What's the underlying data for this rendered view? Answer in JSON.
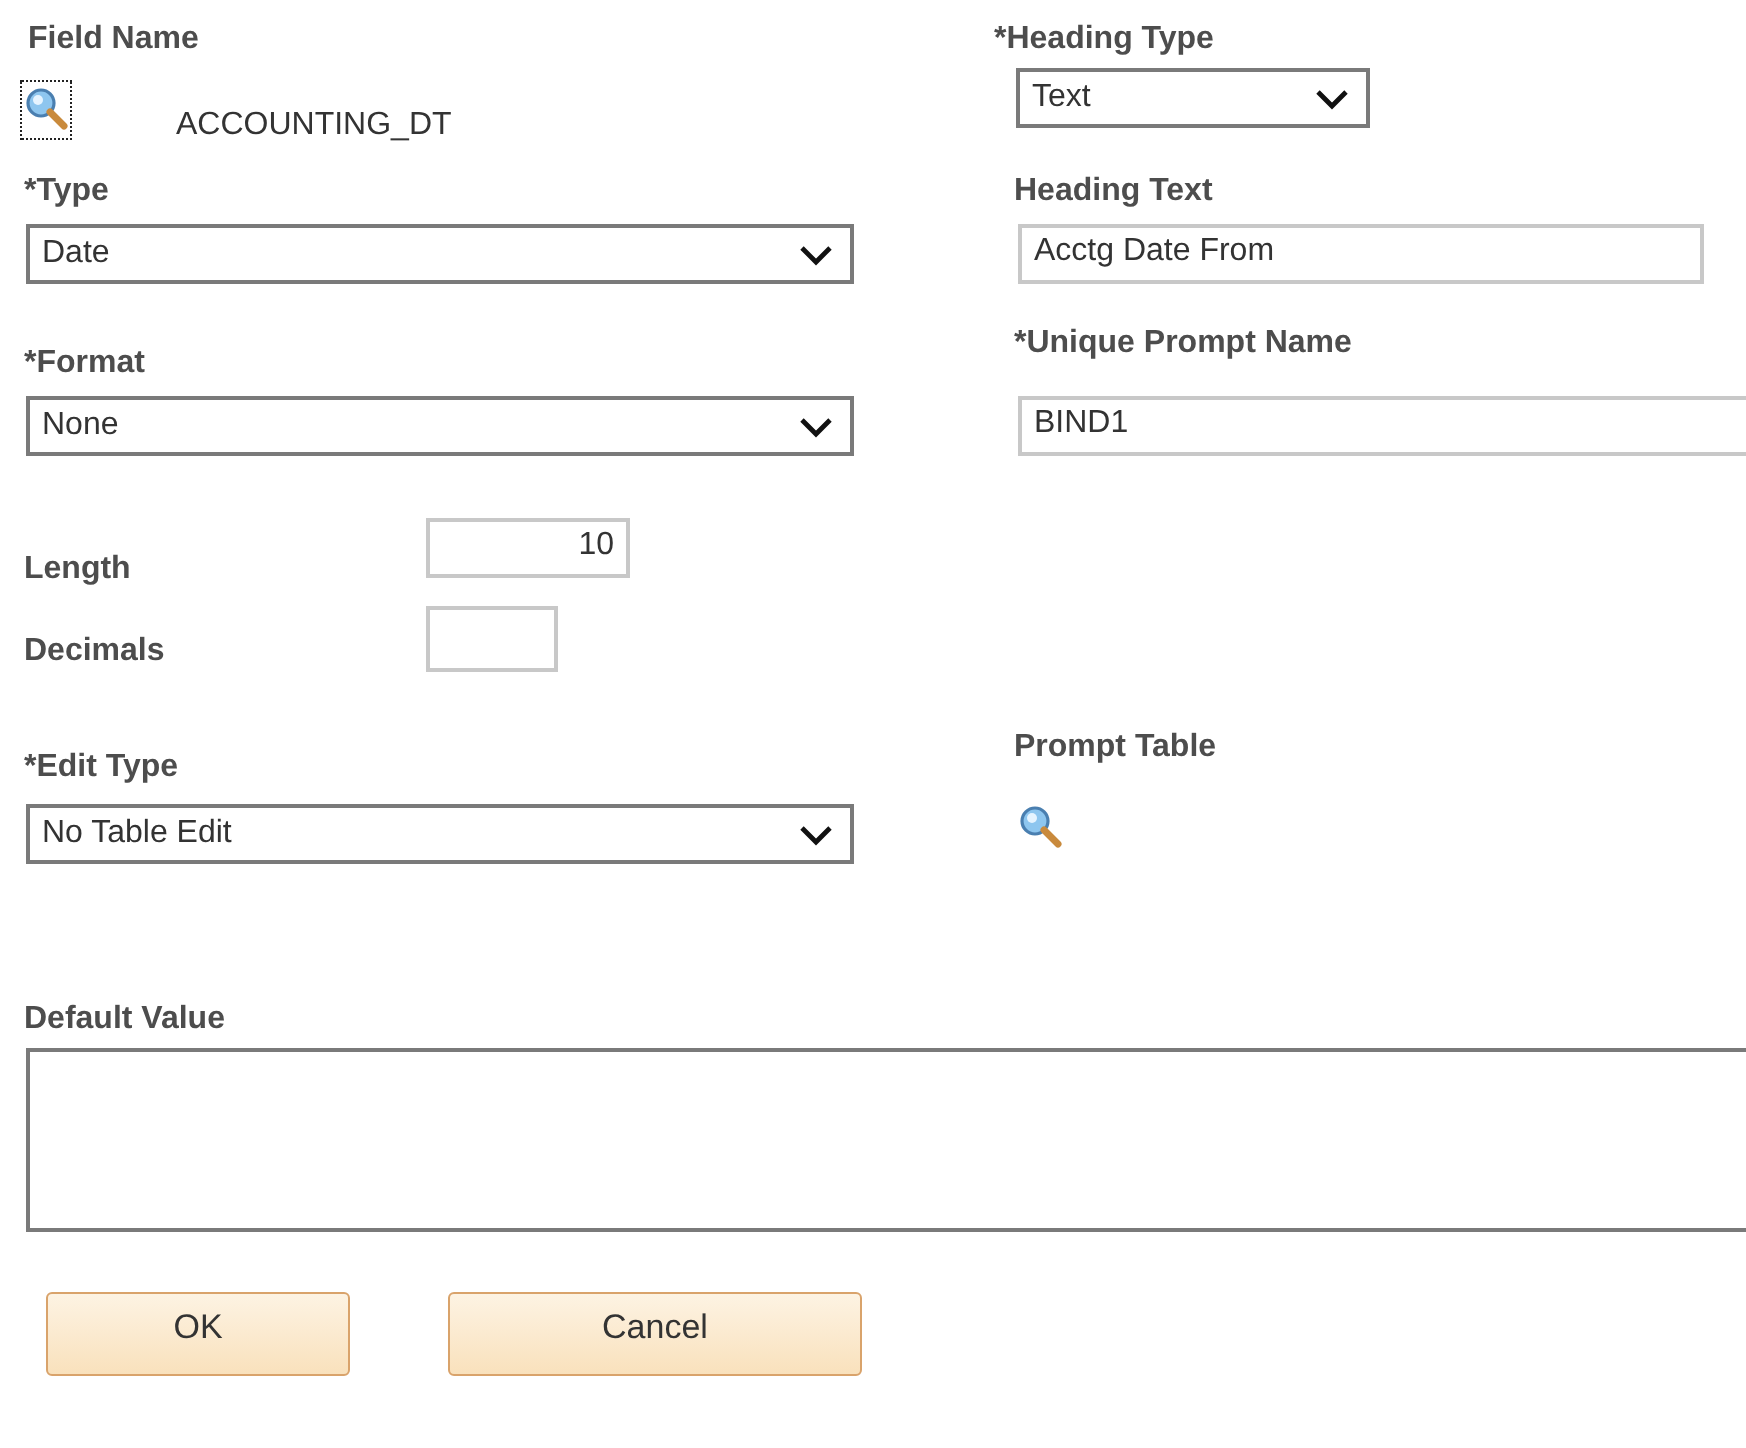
{
  "field_name": {
    "label": "Field Name",
    "value": "ACCOUNTING_DT"
  },
  "heading_type": {
    "label": "*Heading Type",
    "value": "Text"
  },
  "type": {
    "label": "*Type",
    "value": "Date"
  },
  "heading_text": {
    "label": "Heading Text",
    "value": "Acctg Date From"
  },
  "format": {
    "label": "*Format",
    "value": "None"
  },
  "unique_prompt_name": {
    "label": "*Unique Prompt Name",
    "value": "BIND1"
  },
  "length": {
    "label": "Length",
    "value": "10"
  },
  "decimals": {
    "label": "Decimals"
  },
  "edit_type": {
    "label": "*Edit Type",
    "value": "No Table Edit"
  },
  "prompt_table": {
    "label": "Prompt Table"
  },
  "default_value": {
    "label": "Default Value"
  },
  "buttons": [
    "OK",
    "Cancel"
  ]
}
